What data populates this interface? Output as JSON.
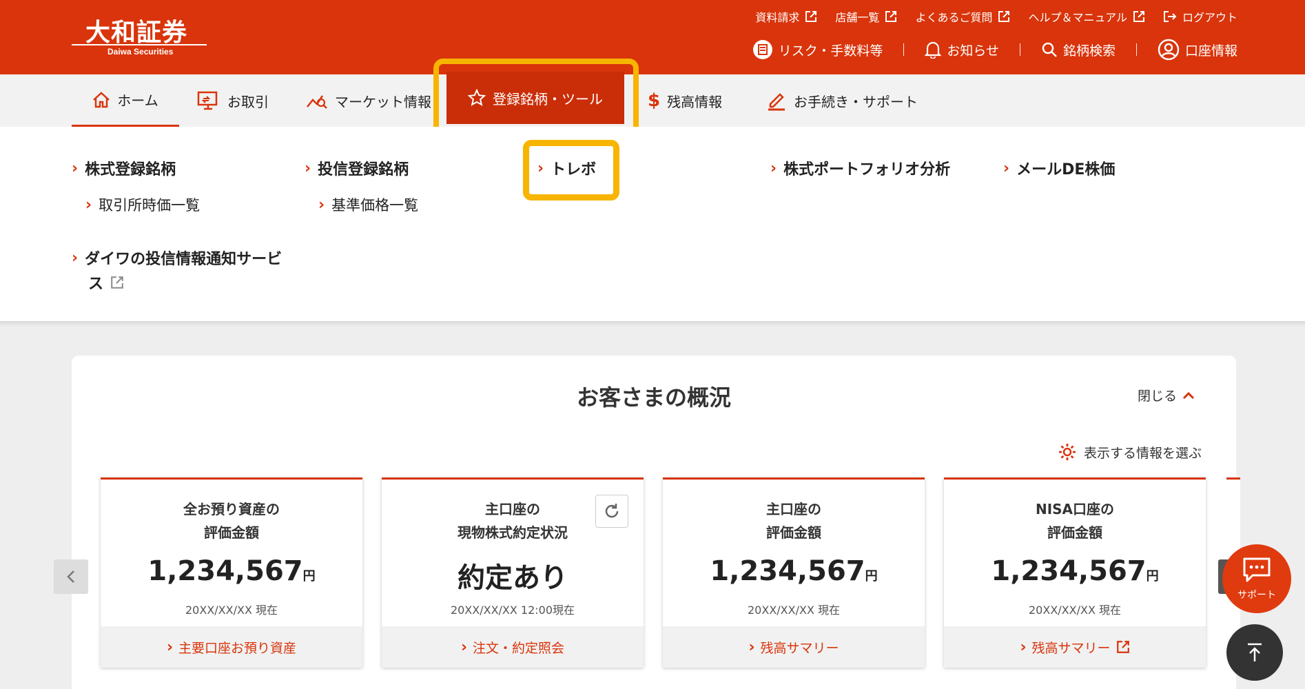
{
  "header": {
    "logo_jp": "大和証券",
    "logo_en": "Daiwa Securities",
    "util_links": [
      {
        "label": "資料請求",
        "icon": "external-link-icon"
      },
      {
        "label": "店舗一覧",
        "icon": "external-link-icon"
      },
      {
        "label": "よくあるご質問",
        "icon": "external-link-icon"
      },
      {
        "label": "ヘルプ＆マニュアル",
        "icon": "external-link-icon"
      },
      {
        "label": "ログアウト",
        "icon": "logout-icon"
      }
    ],
    "util_items": [
      {
        "label": "リスク・手数料等",
        "icon": "document-icon"
      },
      {
        "label": "お知らせ",
        "icon": "bell-icon"
      },
      {
        "label": "銘柄検索",
        "icon": "search-icon"
      },
      {
        "label": "口座情報",
        "icon": "user-icon"
      }
    ]
  },
  "nav": {
    "items": [
      {
        "label": "ホーム",
        "icon": "home-icon"
      },
      {
        "label": "お取引",
        "icon": "trade-icon"
      },
      {
        "label": "マーケット情報",
        "icon": "market-chart-icon"
      },
      {
        "label": "登録銘柄・ツール",
        "icon": "star-icon"
      },
      {
        "label": "残高情報",
        "icon": "dollar-icon"
      },
      {
        "label": "お手続き・サポート",
        "icon": "pen-icon"
      }
    ]
  },
  "mega": {
    "stock_registered": "株式登録銘柄",
    "stock_sub": "取引所時価一覧",
    "fund_registered": "投信登録銘柄",
    "fund_sub": "基準価格一覧",
    "trebo": "トレボ",
    "portfolio": "株式ポートフォリオ分析",
    "mail": "メールDE株価",
    "notify_line1": "ダイワの投信情報通知サービ",
    "notify_line2": "ス"
  },
  "overview": {
    "title": "お客さまの概況",
    "close_label": "閉じる",
    "select_label": "表示する情報を選ぶ",
    "cards": [
      {
        "title1": "全お預り資産の",
        "title2": "評価金額",
        "value": "1,234,567",
        "unit": "円",
        "date": "20XX/XX/XX 現在",
        "link": "主要口座お預り資産"
      },
      {
        "title1": "主口座の",
        "title2": "現物株式約定状況",
        "value": "約定あり",
        "unit": "",
        "date": "20XX/XX/XX 12:00現在",
        "link": "注文・約定照会"
      },
      {
        "title1": "主口座の",
        "title2": "評価金額",
        "value": "1,234,567",
        "unit": "円",
        "date": "20XX/XX/XX 現在",
        "link": "残高サマリー"
      },
      {
        "title1": "NISA口座の",
        "title2": "評価金額",
        "value": "1,234,567",
        "unit": "円",
        "date": "20XX/XX/XX 現在",
        "link": "残高サマリー"
      }
    ]
  },
  "fab": {
    "support_label": "サポート"
  },
  "colors": {
    "brand": "#d9340b",
    "highlight": "#f7b400"
  }
}
